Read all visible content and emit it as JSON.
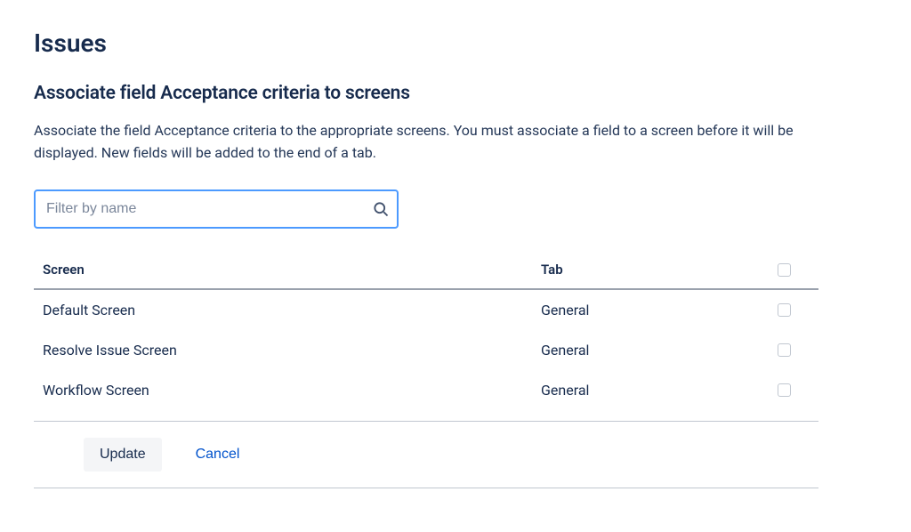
{
  "page_title": "Issues",
  "section_title": "Associate field Acceptance criteria to screens",
  "description": "Associate the field Acceptance criteria to the appropriate screens. You must associate a field to a screen before it will be displayed. New fields will be added to the end of a tab.",
  "filter": {
    "placeholder": "Filter by name",
    "value": ""
  },
  "table": {
    "headers": {
      "screen": "Screen",
      "tab": "Tab"
    },
    "rows": [
      {
        "screen": "Default Screen",
        "tab": "General",
        "checked": false
      },
      {
        "screen": "Resolve Issue Screen",
        "tab": "General",
        "checked": false
      },
      {
        "screen": "Workflow Screen",
        "tab": "General",
        "checked": false
      }
    ]
  },
  "buttons": {
    "update": "Update",
    "cancel": "Cancel"
  }
}
